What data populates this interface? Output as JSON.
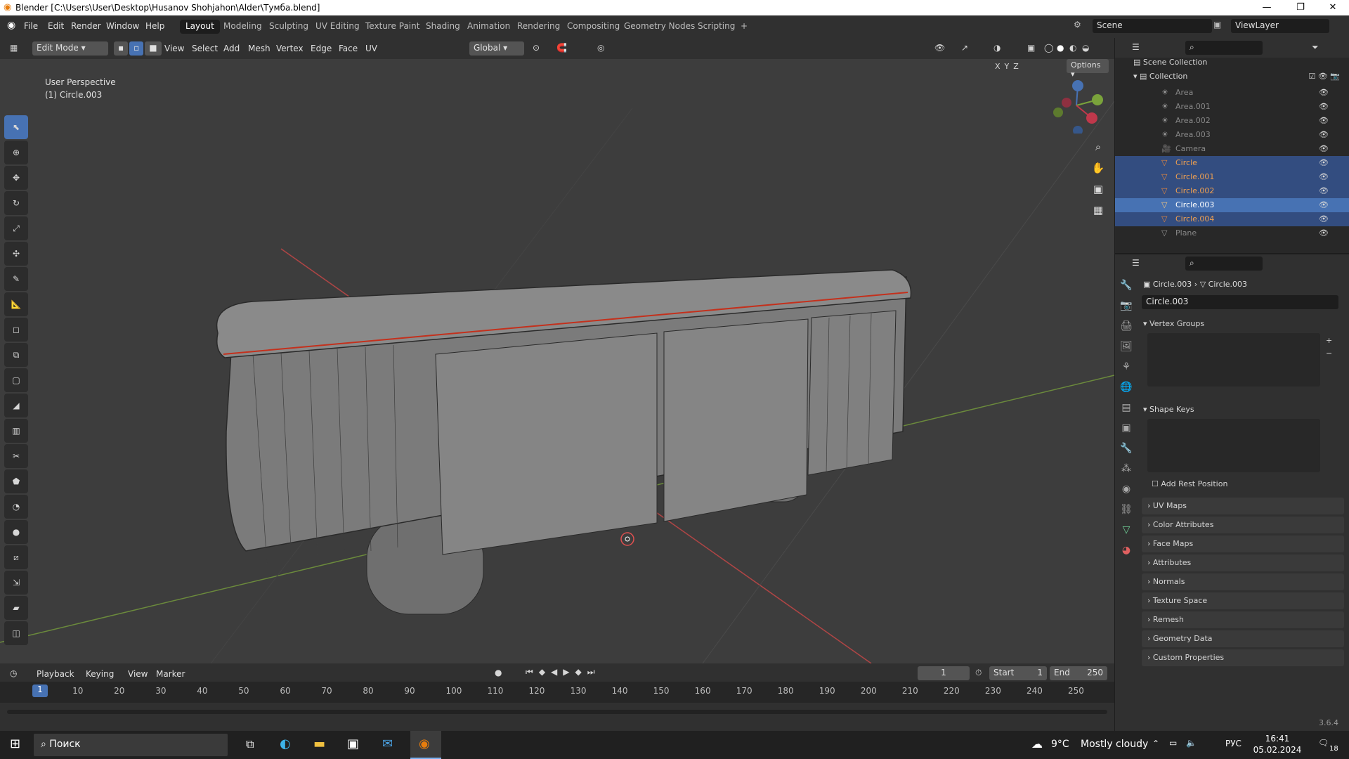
{
  "window": {
    "title": "Blender [C:\\Users\\User\\Desktop\\Husanov Shohjahon\\Alder\\Тумба.blend]",
    "min": "—",
    "max": "❐",
    "close": "✕"
  },
  "menu": [
    "File",
    "Edit",
    "Render",
    "Window",
    "Help"
  ],
  "workspaces": [
    "Layout",
    "Modeling",
    "Sculpting",
    "UV Editing",
    "Texture Paint",
    "Shading",
    "Animation",
    "Rendering",
    "Compositing",
    "Geometry Nodes",
    "Scripting",
    "+"
  ],
  "scene": {
    "scene_name": "Scene",
    "view_layer": "ViewLayer"
  },
  "viewport_header": {
    "mode": "Edit Mode",
    "menus": [
      "View",
      "Select",
      "Add",
      "Mesh",
      "Vertex",
      "Edge",
      "Face",
      "UV"
    ],
    "orientation": "Global",
    "axes": [
      "X",
      "Y",
      "Z"
    ],
    "options": "Options"
  },
  "viewport": {
    "perspective": "User Perspective",
    "object_label": "(1) Circle.003"
  },
  "outliner": {
    "root": "Scene Collection",
    "collection": "Collection",
    "items": [
      {
        "name": "Area",
        "state": "normal"
      },
      {
        "name": "Area.001",
        "state": "normal"
      },
      {
        "name": "Area.002",
        "state": "normal"
      },
      {
        "name": "Area.003",
        "state": "normal"
      },
      {
        "name": "Camera",
        "state": "normal"
      },
      {
        "name": "Circle",
        "state": "sel"
      },
      {
        "name": "Circle.001",
        "state": "sel"
      },
      {
        "name": "Circle.002",
        "state": "sel"
      },
      {
        "name": "Circle.003",
        "state": "active"
      },
      {
        "name": "Circle.004",
        "state": "sel"
      },
      {
        "name": "Plane",
        "state": "normal"
      }
    ]
  },
  "properties": {
    "breadcrumb_object": "Circle.003",
    "breadcrumb_data": "Circle.003",
    "data_name": "Circle.003",
    "vertex_groups": "Vertex Groups",
    "shape_keys": "Shape Keys",
    "add_rest": "Add Rest Position",
    "panels": [
      "UV Maps",
      "Color Attributes",
      "Face Maps",
      "Attributes",
      "Normals",
      "Texture Space",
      "Remesh",
      "Geometry Data",
      "Custom Properties"
    ]
  },
  "timeline": {
    "menus": [
      "Playback",
      "Keying",
      "View",
      "Marker"
    ],
    "current_frame": "1",
    "start_label": "Start",
    "start": "1",
    "end_label": "End",
    "end": "250",
    "ticks": [
      "1",
      "10",
      "20",
      "30",
      "40",
      "50",
      "60",
      "70",
      "80",
      "90",
      "100",
      "110",
      "120",
      "130",
      "140",
      "150",
      "160",
      "170",
      "180",
      "190",
      "200",
      "210",
      "220",
      "230",
      "240",
      "250"
    ]
  },
  "status": {
    "version": "3.6.4"
  },
  "taskbar": {
    "search": "Поиск",
    "weather_temp": "9°C",
    "weather_text": "Mostly cloudy",
    "lang": "РУС",
    "time": "16:41",
    "date": "05.02.2024",
    "notifications": "18"
  }
}
